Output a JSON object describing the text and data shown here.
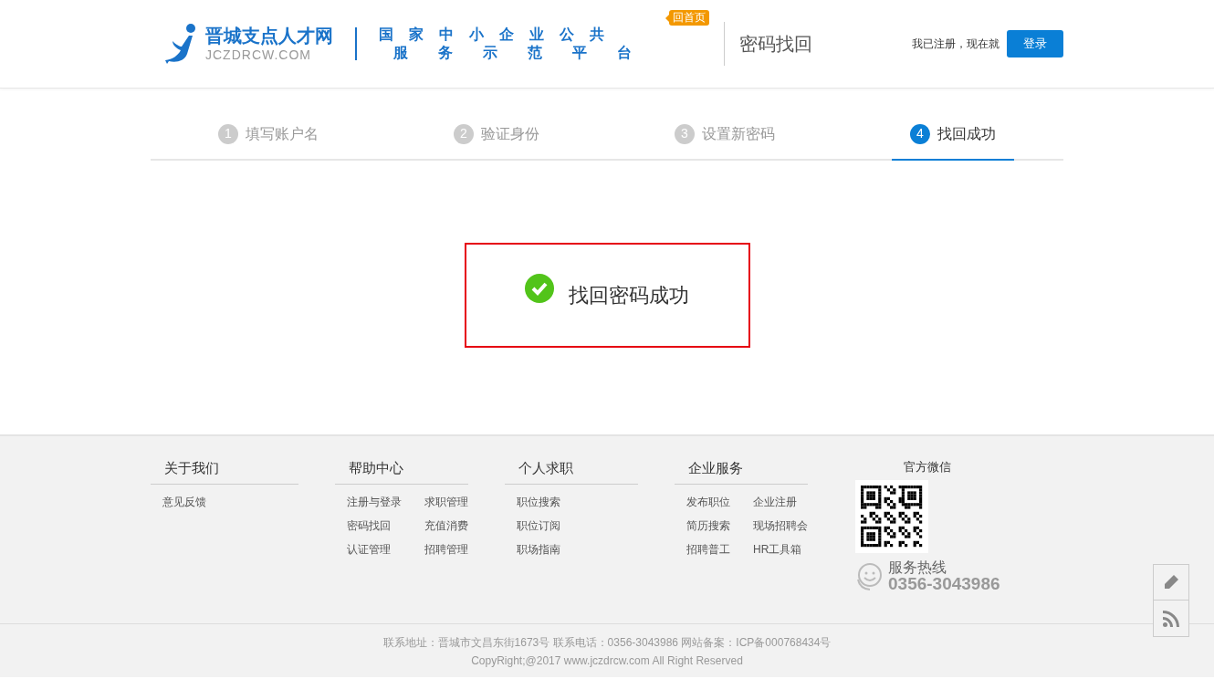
{
  "header": {
    "logo_name": "晋城支点人才网",
    "logo_domain": "JCZDRCW.COM",
    "slogan_lines": [
      "国家中小企业公共",
      "服务示范平台"
    ],
    "home_badge": "回首页",
    "page_title": "密码找回",
    "login_prompt": "我已注册，现在就",
    "login_button": "登录"
  },
  "steps": [
    {
      "number": "1",
      "label": "填写账户名",
      "selected": false
    },
    {
      "number": "2",
      "label": "验证身份",
      "selected": false
    },
    {
      "number": "3",
      "label": "设置新密码",
      "selected": false
    },
    {
      "number": "4",
      "label": "找回成功",
      "selected": true
    }
  ],
  "result": {
    "kind": "success",
    "message": "找回密码成功"
  },
  "footer": {
    "columns": [
      {
        "title": "关于我们",
        "kind": "list",
        "links": [
          "意见反馈"
        ]
      },
      {
        "title": "帮助中心",
        "kind": "grid",
        "links": [
          "注册与登录",
          "求职管理",
          "密码找回",
          "充值消费",
          "认证管理",
          "招聘管理"
        ]
      },
      {
        "title": "个人求职",
        "kind": "list",
        "links": [
          "职位搜索",
          "职位订阅",
          "职场指南"
        ]
      },
      {
        "title": "企业服务",
        "kind": "grid",
        "links": [
          "发布职位",
          "企业注册",
          "简历搜索",
          "现场招聘会",
          "招聘普工",
          "HR工具箱"
        ]
      }
    ],
    "wechat_title": "官方微信",
    "hotline_label": "服务热线",
    "hotline_number": "0356-3043986",
    "address_line": "联系地址：晋城市文昌东街1673号 联系电话：0356-3043986 网站备案：ICP备000768434号",
    "copyright": "CopyRight;@2017 www.jczdrcw.com All Right Reserved"
  }
}
